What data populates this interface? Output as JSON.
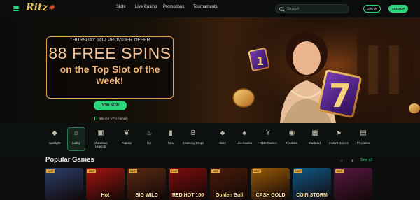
{
  "header": {
    "logo": "Ritz",
    "nav": [
      "Slots",
      "Live Casino",
      "Promotions",
      "Tournaments"
    ],
    "search_placeholder": "Search",
    "login": "LOG IN",
    "signup": "SIGN UP"
  },
  "hero": {
    "line1": "THURSDAY TOP PROVIDER OFFER",
    "line2": "88 FREE SPINS",
    "line3": "on the Top Slot of the week!",
    "join": "JOIN NOW",
    "vpn": "We are VPN friendly",
    "slides": 6,
    "active_slide": 5
  },
  "categories": [
    {
      "label": "Spotlight",
      "icon": "diamond-icon"
    },
    {
      "label": "Lobby",
      "icon": "lobby-icon"
    },
    {
      "label": "Christmas Legends",
      "icon": "gift-icon"
    },
    {
      "label": "Popular",
      "icon": "laurel-icon"
    },
    {
      "label": "Hot",
      "icon": "flame-icon"
    },
    {
      "label": "New",
      "icon": "new-tag-icon"
    },
    {
      "label": "BGaming Drops",
      "icon": "drops-icon"
    },
    {
      "label": "Slots",
      "icon": "cherry-icon"
    },
    {
      "label": "Live Casino",
      "icon": "cards-icon"
    },
    {
      "label": "Table Games",
      "icon": "cocktail-icon"
    },
    {
      "label": "Roulette",
      "icon": "roulette-icon"
    },
    {
      "label": "Blackjack",
      "icon": "blackjack-icon"
    },
    {
      "label": "Instant Games",
      "icon": "rocket-icon"
    },
    {
      "label": "Providers",
      "icon": "providers-icon"
    }
  ],
  "popular": {
    "title": "Popular Games",
    "see_all": "See all",
    "games": [
      {
        "title": "",
        "badge": "HOT",
        "color": "#2a3f6b"
      },
      {
        "title": "Hot",
        "badge": "HOT",
        "color": "#a3150f"
      },
      {
        "title": "BIG WILD",
        "badge": "HOT",
        "color": "#5a2a12"
      },
      {
        "title": "RED HOT 100",
        "badge": "HOT",
        "color": "#7e0c0c"
      },
      {
        "title": "Golden Bull",
        "badge": "HOT",
        "color": "#4a1c08"
      },
      {
        "title": "CASH GOLD",
        "badge": "HOT",
        "color": "#9a5a08"
      },
      {
        "title": "COIN STORM",
        "badge": "HOT",
        "color": "#0f5a8a"
      },
      {
        "title": "",
        "badge": "HOT",
        "color": "#5a1742"
      }
    ]
  }
}
